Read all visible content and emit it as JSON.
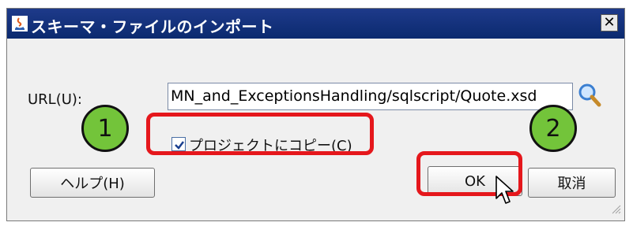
{
  "dialog": {
    "title": "スキーマ・ファイルのインポート",
    "close_label": "✕"
  },
  "url": {
    "label": "URL(U):",
    "value": "MN_and_ExceptionsHandling/sqlscript/Quote.xsd"
  },
  "copy_to_project": {
    "label": "プロジェクトにコピー(C)",
    "checked": true
  },
  "buttons": {
    "help": "ヘルプ(H)",
    "ok": "OK",
    "cancel": "取消"
  },
  "annotations": {
    "step1": "1",
    "step2": "2",
    "highlight_color": "#e5171c",
    "step_color": "#73c43a"
  },
  "icons": {
    "app": "java-app-icon",
    "search": "magnifier-icon",
    "cursor": "mouse-pointer-icon"
  }
}
